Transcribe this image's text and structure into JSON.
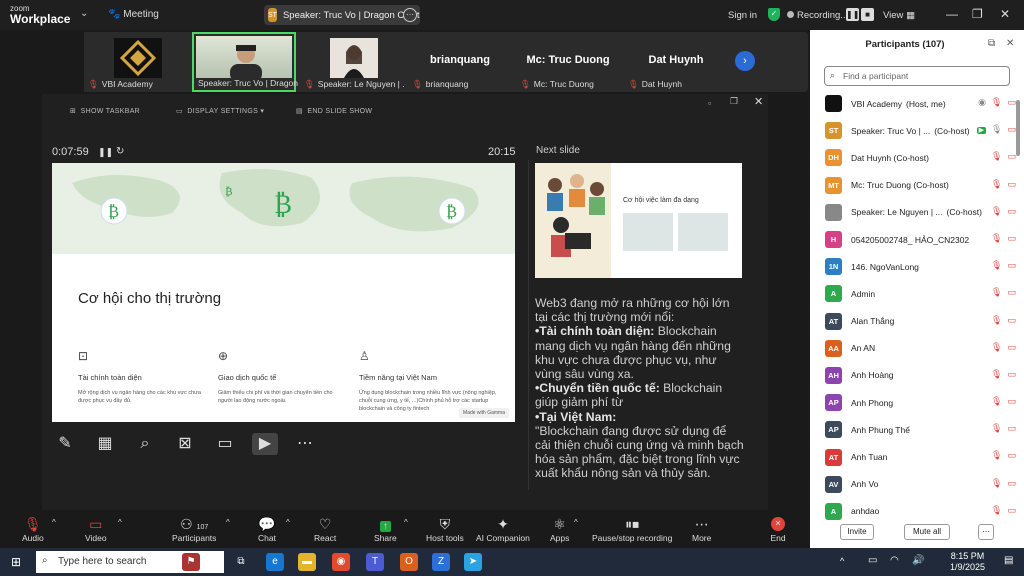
{
  "app": {
    "logo_line1": "zoom",
    "logo_line2": "Workplace",
    "meeting_label": "Meeting"
  },
  "topbar": {
    "speaker_pill": "Speaker: Truc Vo | Dragon Capital",
    "speaker_badge": "ST",
    "sign_in": "Sign in",
    "recording": "Recording...",
    "view": "View"
  },
  "strip": {
    "tiles": [
      {
        "name": "VBI Academy",
        "big": ""
      },
      {
        "name": "Speaker: Truc Vo | Dragon ...",
        "big": ""
      },
      {
        "name": "Speaker: Le Nguyen | ...",
        "big": ""
      },
      {
        "name": "brianquang",
        "big": "brianquang"
      },
      {
        "name": "Mc: Truc Duong",
        "big": "Mc: Truc Duong"
      },
      {
        "name": "Dat Huynh",
        "big": "Dat Huynh"
      }
    ]
  },
  "presenter": {
    "show_taskbar": "SHOW TASKBAR",
    "display_settings": "DISPLAY SETTINGS ▾",
    "end_slide_show": "END SLIDE SHOW",
    "elapsed": "0:07:59",
    "clock": "20:15",
    "next_slide_label": "Next slide"
  },
  "slide": {
    "title": "Cơ hội cho thị trường",
    "columns": [
      {
        "title": "Tài chính toàn diện",
        "desc": "Mở rộng dịch vụ ngân hàng cho các khu vực chưa được phục vụ đầy đủ."
      },
      {
        "title": "Giao dịch quốc tế",
        "desc": "Giảm thiểu chi phí và thời gian chuyển tiền cho người lao động nước ngoài."
      },
      {
        "title": "Tiềm năng tại Việt Nam",
        "desc": "Ứng dụng blockchain trong nhiều lĩnh vực (nông nghiệp, chuỗi cung ứng, y tế, ...)Chính phủ hỗ trợ các startup blockchain và công ty fintech"
      }
    ],
    "badge": "Made with Gamma"
  },
  "next_slide": {
    "title": "Cơ hội việc làm đa dạng"
  },
  "notes": {
    "intro": "Web3 đang mở ra những cơ hội lớn tại các thị trường mới nổi:",
    "b1_head": "•Tài chính toàn diện:",
    "b1_body": " Blockchain mang dịch vụ ngân hàng đến những khu vực chưa được phục vụ, như vùng sâu vùng xa.",
    "b2_head": "•Chuyển tiền quốc tế:",
    "b2_body": " Blockchain giúp giảm phí từ",
    "b3_head": "•Tại Việt Nam:",
    "b3_body": "\"Blockchain đang được sử dụng để cải thiện chuỗi cung ứng và minh bạch hóa sản phẩm, đặc biệt trong lĩnh vực xuất khẩu nông sản và thủy sản."
  },
  "bottom": {
    "audio": "Audio",
    "video": "Video",
    "participants": "Participants",
    "participants_count": "107",
    "chat": "Chat",
    "react": "React",
    "share": "Share",
    "host_tools": "Host tools",
    "ai_companion": "AI Companion",
    "apps": "Apps",
    "pause_rec": "Pause/stop recording",
    "more": "More",
    "end": "End"
  },
  "panel": {
    "title": "Participants (107)",
    "search_placeholder": "Find a participant",
    "invite": "Invite",
    "mute_all": "Mute all",
    "participants": [
      {
        "initials": "",
        "name": "VBI Academy",
        "tag": "(Host, me)",
        "color": "#111111"
      },
      {
        "initials": "ST",
        "name": "Speaker: Truc Vo | ...",
        "tag": "(Co-host)",
        "color": "#d4952d"
      },
      {
        "initials": "DH",
        "name": "Dat Huynh (Co-host)",
        "tag": "",
        "color": "#e8932f"
      },
      {
        "initials": "MT",
        "name": "Mc: Truc Duong (Co-host)",
        "tag": "",
        "color": "#e8932f"
      },
      {
        "initials": "",
        "name": "Speaker: Le Nguyen | ...",
        "tag": "(Co-host)",
        "color": "#888888"
      },
      {
        "initials": "H",
        "name": "054205002748_ HẢO_CN2302A",
        "tag": "",
        "color": "#d83f87"
      },
      {
        "initials": "1N",
        "name": "146. NgoVanLong",
        "tag": "",
        "color": "#2d7fc1"
      },
      {
        "initials": "A",
        "name": "Admin",
        "tag": "",
        "color": "#2fa84f"
      },
      {
        "initials": "AT",
        "name": "Alan Thắng",
        "tag": "",
        "color": "#3d4a5c"
      },
      {
        "initials": "AA",
        "name": "An AN",
        "tag": "",
        "color": "#d9601f"
      },
      {
        "initials": "AH",
        "name": "Anh Hoàng",
        "tag": "",
        "color": "#8e44ad"
      },
      {
        "initials": "AP",
        "name": "Anh Phong",
        "tag": "",
        "color": "#8e44ad"
      },
      {
        "initials": "AP",
        "name": "Anh Phung Thế",
        "tag": "",
        "color": "#3d4a5c"
      },
      {
        "initials": "AT",
        "name": "Anh Tuan",
        "tag": "",
        "color": "#d93b3b"
      },
      {
        "initials": "AV",
        "name": "Anh Vo",
        "tag": "",
        "color": "#3d4a5c"
      },
      {
        "initials": "A",
        "name": "anhdao",
        "tag": "",
        "color": "#2fa84f"
      }
    ]
  },
  "taskbar": {
    "search": "Type here to search",
    "time": "8:15 PM",
    "date": "1/9/2025"
  }
}
